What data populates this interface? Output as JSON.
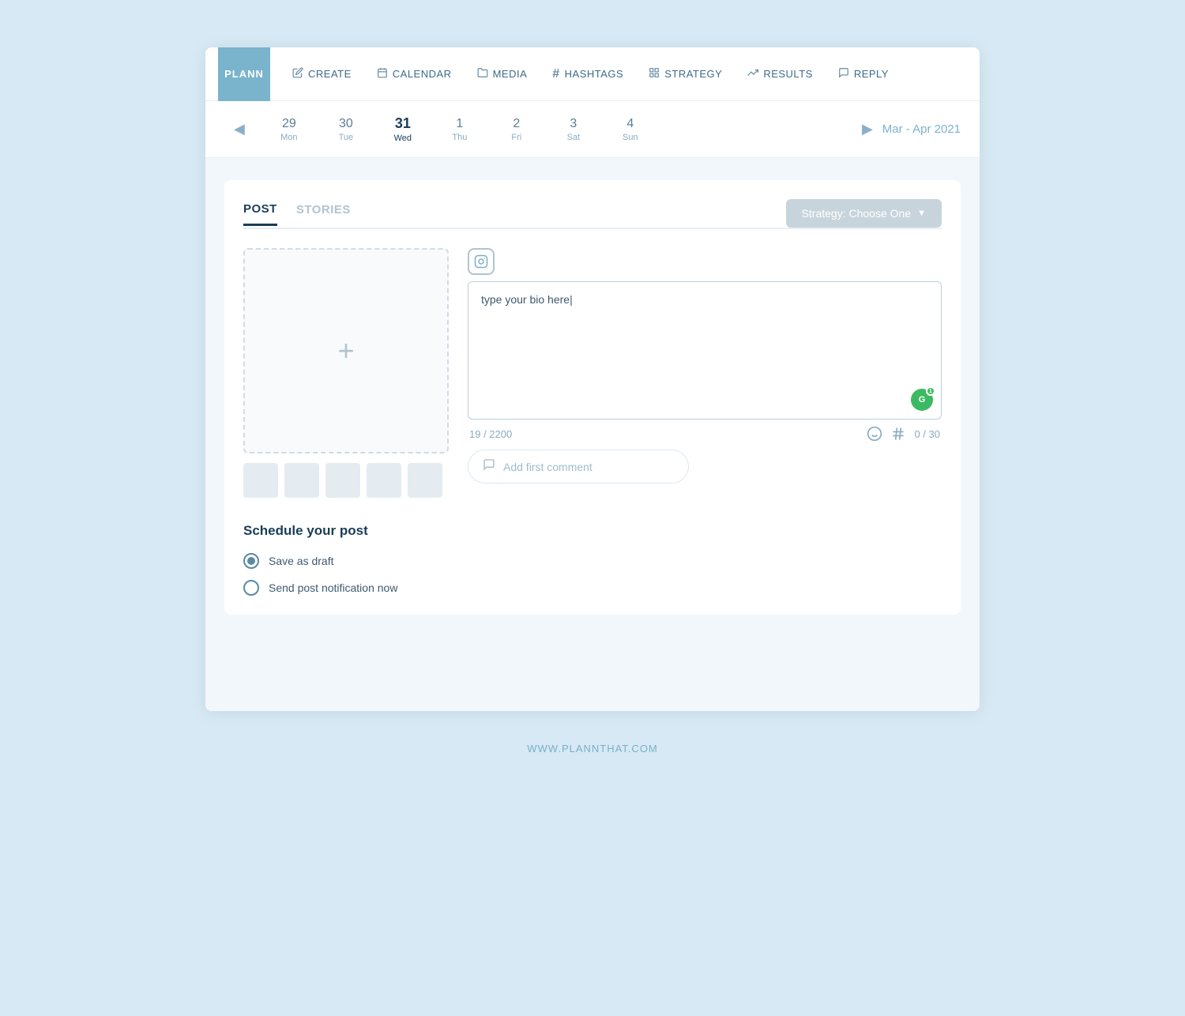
{
  "logo": {
    "text": "PLANN"
  },
  "nav": {
    "items": [
      {
        "id": "create",
        "label": "CREATE",
        "icon": "✏️"
      },
      {
        "id": "calendar",
        "label": "CALENDAR",
        "icon": "📅"
      },
      {
        "id": "media",
        "label": "MEDIA",
        "icon": "📁"
      },
      {
        "id": "hashtags",
        "label": "HASHTAGS",
        "icon": "#"
      },
      {
        "id": "strategy",
        "label": "STRATEGY",
        "icon": "⊞"
      },
      {
        "id": "results",
        "label": "RESULTS",
        "icon": "📈"
      },
      {
        "id": "reply",
        "label": "REPLY",
        "icon": "💬"
      }
    ]
  },
  "calendar": {
    "range_label": "Mar - Apr 2021",
    "days": [
      {
        "num": "29",
        "name": "Mon",
        "active": false
      },
      {
        "num": "30",
        "name": "Tue",
        "active": false
      },
      {
        "num": "31",
        "name": "Wed",
        "active": true
      },
      {
        "num": "1",
        "name": "Thu",
        "active": false
      },
      {
        "num": "2",
        "name": "Fri",
        "active": false
      },
      {
        "num": "3",
        "name": "Sat",
        "active": false
      },
      {
        "num": "4",
        "name": "Sun",
        "active": false
      }
    ]
  },
  "tabs": [
    {
      "id": "post",
      "label": "POST",
      "active": true
    },
    {
      "id": "stories",
      "label": "STORIES",
      "active": false
    }
  ],
  "strategy_button": {
    "label": "Strategy: Choose One"
  },
  "caption": {
    "placeholder": "type your bio here|",
    "char_count": "19 / 2200",
    "hashtag_count": "0 / 30"
  },
  "comment": {
    "placeholder": "Add first comment"
  },
  "schedule": {
    "title": "Schedule your post",
    "options": [
      {
        "id": "draft",
        "label": "Save as draft",
        "checked": true
      },
      {
        "id": "notify",
        "label": "Send post notification now",
        "checked": false
      }
    ]
  },
  "footer": {
    "text": "WWW.PLANNTHAT.COM"
  }
}
